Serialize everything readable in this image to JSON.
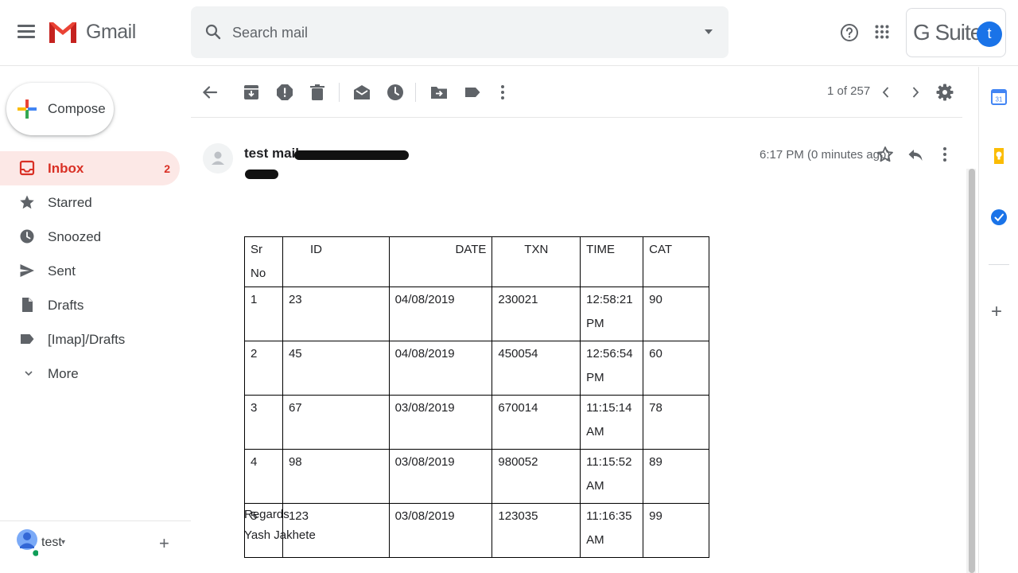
{
  "app": {
    "name": "Gmail"
  },
  "search": {
    "placeholder": "Search mail"
  },
  "gsuite": {
    "label": "G Suite",
    "avatar_letter": "t"
  },
  "compose": {
    "label": "Compose"
  },
  "nav": {
    "inbox": {
      "label": "Inbox",
      "count": "2"
    },
    "starred": {
      "label": "Starred"
    },
    "snoozed": {
      "label": "Snoozed"
    },
    "sent": {
      "label": "Sent"
    },
    "drafts": {
      "label": "Drafts"
    },
    "imap_drafts": {
      "label": "[Imap]/Drafts"
    },
    "more": {
      "label": "More"
    }
  },
  "user": {
    "name": "test",
    "caret": "▾"
  },
  "toolbar": {
    "pager": "1 of 257"
  },
  "email": {
    "sender": "test mail",
    "time": "6:17 PM (0 minutes ago)",
    "table": {
      "headers": [
        "Sr No",
        "ID",
        "DATE",
        "TXN",
        "TIME",
        "CAT"
      ],
      "rows": [
        [
          "1",
          "23",
          "04/08/2019",
          "230021",
          "12:58:21 PM",
          "90"
        ],
        [
          "2",
          "45",
          "04/08/2019",
          "450054",
          "12:56:54 PM",
          "60"
        ],
        [
          "3",
          "67",
          "03/08/2019",
          "670014",
          "11:15:14 AM",
          "78"
        ],
        [
          "4",
          "98",
          "03/08/2019",
          "980052",
          "11:15:52 AM",
          "89"
        ],
        [
          "5",
          "123",
          "03/08/2019",
          "123035",
          "11:16:35 AM",
          "99"
        ]
      ]
    },
    "signature": {
      "line1": "Regards",
      "line2": "Yash Jakhete"
    }
  },
  "colors": {
    "gmail_red": "#d93025",
    "active_bg": "#fce8e6",
    "accent_blue": "#1a73e8"
  }
}
